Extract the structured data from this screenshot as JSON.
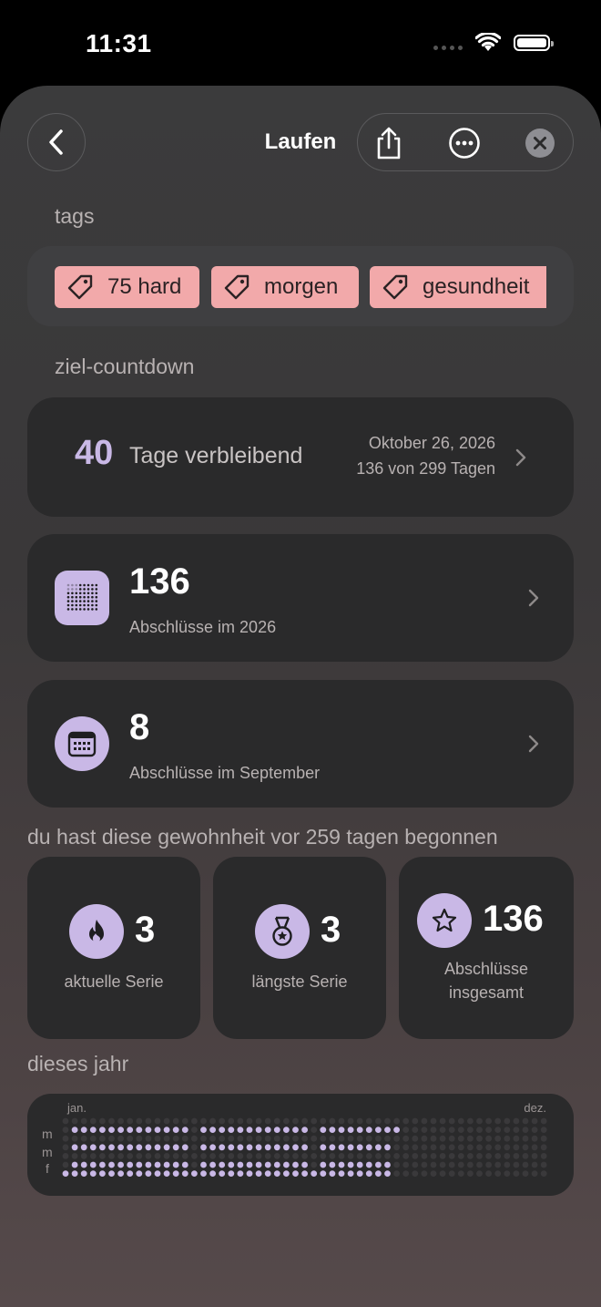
{
  "status_bar": {
    "time": "11:31"
  },
  "header": {
    "title": "Laufen"
  },
  "tags": {
    "section_label": "tags",
    "items": [
      "75 hard",
      "morgen",
      "gesundheit"
    ]
  },
  "countdown": {
    "section_label": "ziel-countdown",
    "days": "40",
    "days_label": "Tage verbleibend",
    "date": "Oktober 26, 2026",
    "progress_text": "136 von 299 Tagen"
  },
  "year_stat": {
    "value": "136",
    "label": "Abschlüsse im 2026"
  },
  "month_stat": {
    "value": "8",
    "label": "Abschlüsse im September"
  },
  "started_text": "du hast diese gewohnheit vor 259 tagen begonnen",
  "streaks": [
    {
      "icon": "flame-icon",
      "value": "3",
      "label": "aktuelle Serie"
    },
    {
      "icon": "medal-icon",
      "value": "3",
      "label": "längste Serie"
    },
    {
      "icon": "star-icon",
      "value": "136",
      "label_line1": "Abschlüsse",
      "label_line2": "insgesamt"
    }
  ],
  "this_year": {
    "section_label": "dieses jahr",
    "start_label": "jan.",
    "end_label": "dez.",
    "row_labels": [
      "m",
      "m",
      "f"
    ],
    "completions": 136
  },
  "colors": {
    "accent": "#c9b8e6",
    "tag_bg": "#f2a9aa",
    "card_bg": "#2a2a2b"
  }
}
